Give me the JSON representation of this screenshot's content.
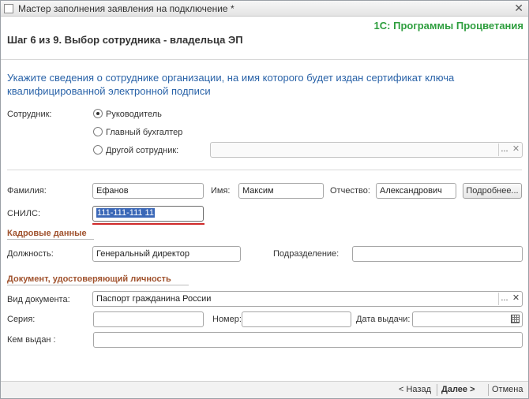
{
  "window": {
    "title": "Мастер заполнения заявления на подключение *",
    "close_glyph": "✕"
  },
  "header": {
    "brand": "1С: Программы Процветания",
    "step_title": "Шаг 6 из 9. Выбор сотрудника - владельца ЭП"
  },
  "intro": "Укажите сведения о сотруднике организации, на имя которого будет издан сертификат ключа квалифицированной электронной подписи",
  "employee": {
    "label": "Сотрудник:",
    "options": [
      "Руководитель",
      "Главный бухгалтер",
      "Другой сотрудник:"
    ],
    "selected_index": 0,
    "other_value": ""
  },
  "person": {
    "surname_label": "Фамилия:",
    "surname": "Ефанов",
    "name_label": "Имя:",
    "name": "Максим",
    "patronymic_label": "Отчество:",
    "patronymic": "Александрович",
    "details_button": "Подробнее...",
    "snils_label": "СНИЛС:",
    "snils": "111-111-111 11"
  },
  "hr": {
    "section_title": "Кадровые данные",
    "position_label": "Должность:",
    "position": "Генеральный директор",
    "department_label": "Подразделение:",
    "department": ""
  },
  "document": {
    "section_title": "Документ, удостоверяющий личность",
    "type_label": "Вид документа:",
    "type": "Паспорт гражданина России",
    "series_label": "Серия:",
    "series": "",
    "number_label": "Номер:",
    "number": "",
    "issue_date_label": "Дата выдачи:",
    "issue_date": "",
    "issued_by_label": "Кем выдан :",
    "issued_by": ""
  },
  "controls": {
    "choose_glyph": "...",
    "clear_glyph": "✕",
    "calendar_icon": "calendar-icon"
  },
  "footer": {
    "back": "< Назад",
    "next": "Далее >",
    "cancel": "Отмена"
  },
  "colors": {
    "brand": "#2e9e3e",
    "intro": "#2a63a8",
    "section": "#a0522d",
    "highlight": "#3a67b7",
    "underline": "#cf2a2a"
  }
}
